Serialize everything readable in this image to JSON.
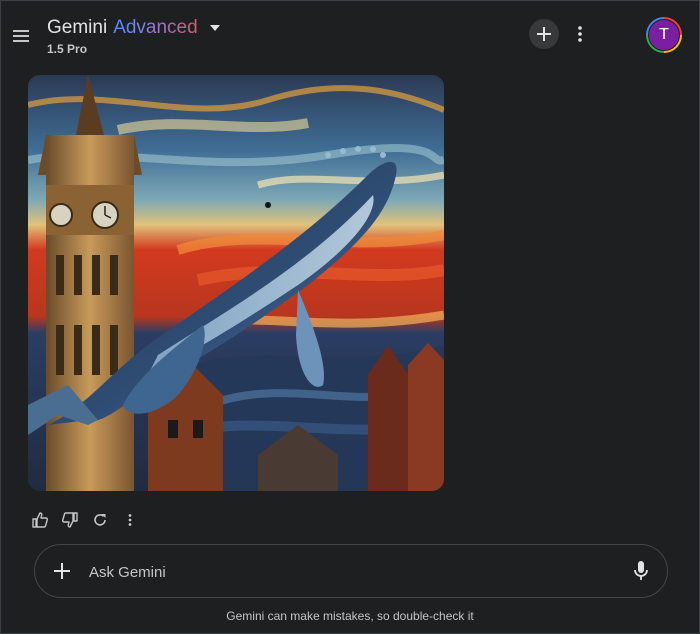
{
  "header": {
    "app_name": "Gemini",
    "tier": "Advanced",
    "model": "1.5 Pro",
    "tier_gradient": [
      "#4b90ff",
      "#8e7bd8",
      "#e0566e"
    ]
  },
  "user": {
    "avatar_initial": "T",
    "avatar_color": "#7b1fa2"
  },
  "icons": {
    "menu": "hamburger-menu-icon",
    "dropdown": "caret-down-icon",
    "new_chat": "plus-icon",
    "more": "more-vertical-icon",
    "thumbs_up": "thumbs-up-icon",
    "thumbs_down": "thumbs-down-icon",
    "regenerate": "refresh-icon",
    "add": "plus-icon",
    "mic": "microphone-icon"
  },
  "response": {
    "image_alt": "Generated painting of a humpback whale flying past a clock tower in a swirling expressionist sky"
  },
  "prompt": {
    "placeholder": "Ask Gemini",
    "value": ""
  },
  "footer": {
    "disclaimer": "Gemini can make mistakes, so double-check it"
  },
  "colors": {
    "background": "#1e1f20",
    "text": "#e3e3e3",
    "muted_text": "#c4c7c5",
    "border": "#444746"
  }
}
